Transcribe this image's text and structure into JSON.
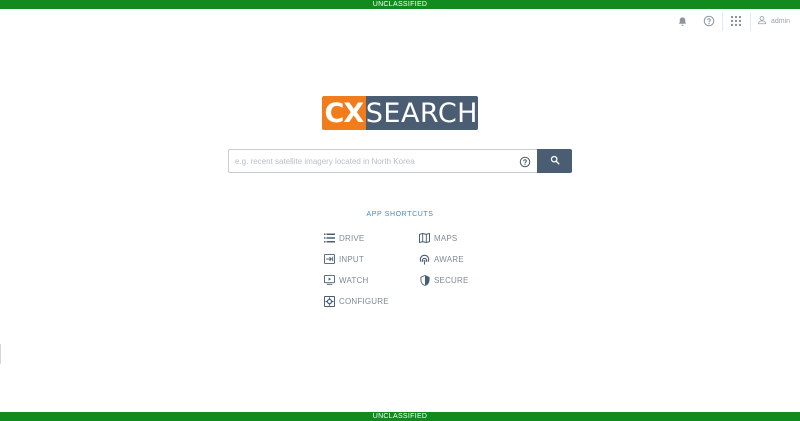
{
  "banner": {
    "top": "UNCLASSIFIED",
    "bottom": "UNCLASSIFIED"
  },
  "topbar": {
    "icons": [
      "bell-icon",
      "help-circle-icon",
      "apps-grid-icon",
      "user-icon"
    ],
    "user_name": "admin"
  },
  "logo": {
    "left": "CX",
    "right": "SEARCH",
    "colors": {
      "left_bg": "#f07c1c",
      "right_bg": "#4a5d73"
    }
  },
  "search": {
    "placeholder": "e.g. recent satellite imagery located in North Korea",
    "value": "",
    "help_icon": "help-circle-icon",
    "button_icon": "search-icon"
  },
  "shortcuts": {
    "title": "APP SHORTCUTS",
    "items": [
      {
        "label": "DRIVE",
        "icon": "list-icon"
      },
      {
        "label": "MAPS",
        "icon": "map-icon"
      },
      {
        "label": "INPUT",
        "icon": "input-icon"
      },
      {
        "label": "AWARE",
        "icon": "signal-icon"
      },
      {
        "label": "WATCH",
        "icon": "play-monitor-icon"
      },
      {
        "label": "SECURE",
        "icon": "shield-icon"
      },
      {
        "label": "CONFIGURE",
        "icon": "configure-icon"
      }
    ]
  },
  "colors": {
    "banner": "#138a1d",
    "accent_text": "#3a8dd0",
    "primary_button": "#4a5d73"
  }
}
